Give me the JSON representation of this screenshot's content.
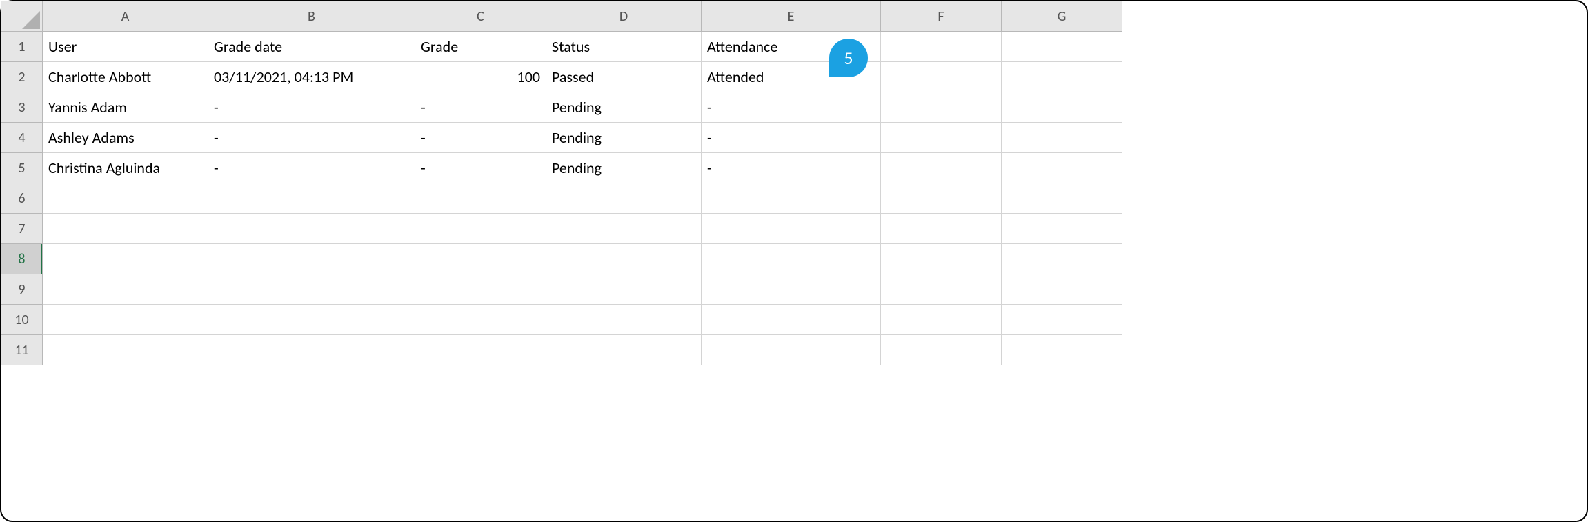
{
  "columns": [
    "A",
    "B",
    "C",
    "D",
    "E",
    "F",
    "G"
  ],
  "rowNumbers": [
    "1",
    "2",
    "3",
    "4",
    "5",
    "6",
    "7",
    "8",
    "9",
    "10",
    "11"
  ],
  "selectedRow": "8",
  "headers": {
    "A": "User",
    "B": "Grade date",
    "C": "Grade",
    "D": "Status",
    "E": "Attendance",
    "F": "",
    "G": ""
  },
  "rows": [
    {
      "A": "Charlotte Abbott",
      "B": "03/11/2021, 04:13 PM",
      "C": "100",
      "D": "Passed",
      "E": "Attended",
      "F": "",
      "G": ""
    },
    {
      "A": "Yannis Adam",
      "B": "-",
      "C": "-",
      "D": "Pending",
      "E": "-",
      "F": "",
      "G": ""
    },
    {
      "A": "Ashley Adams",
      "B": "-",
      "C": "-",
      "D": "Pending",
      "E": "-",
      "F": "",
      "G": ""
    },
    {
      "A": "Christina Agluinda",
      "B": "-",
      "C": "-",
      "D": "Pending",
      "E": "-",
      "F": "",
      "G": ""
    },
    {
      "A": "",
      "B": "",
      "C": "",
      "D": "",
      "E": "",
      "F": "",
      "G": ""
    },
    {
      "A": "",
      "B": "",
      "C": "",
      "D": "",
      "E": "",
      "F": "",
      "G": ""
    },
    {
      "A": "",
      "B": "",
      "C": "",
      "D": "",
      "E": "",
      "F": "",
      "G": ""
    },
    {
      "A": "",
      "B": "",
      "C": "",
      "D": "",
      "E": "",
      "F": "",
      "G": ""
    },
    {
      "A": "",
      "B": "",
      "C": "",
      "D": "",
      "E": "",
      "F": "",
      "G": ""
    },
    {
      "A": "",
      "B": "",
      "C": "",
      "D": "",
      "E": "",
      "F": "",
      "G": ""
    }
  ],
  "callout": {
    "label": "5"
  }
}
